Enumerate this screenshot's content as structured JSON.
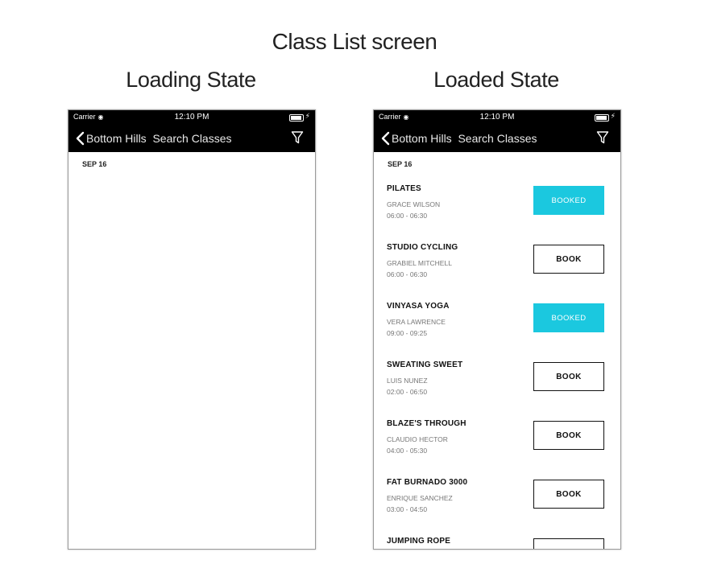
{
  "page_title": "Class List screen",
  "loading": {
    "state_title": "Loading State",
    "status": {
      "carrier": "Carrier",
      "time": "12:10 PM"
    },
    "nav": {
      "title": "Bottom Hills  Search Classes"
    },
    "date_label": "SEP 16"
  },
  "loaded": {
    "state_title": "Loaded State",
    "status": {
      "carrier": "Carrier",
      "time": "12:10 PM"
    },
    "nav": {
      "title": "Bottom Hills  Search Classes"
    },
    "date_label": "SEP 16",
    "classes": [
      {
        "name": "PILATES",
        "instructor": "GRACE WILSON",
        "time": "06:00 - 06:30",
        "button": "BOOKED",
        "booked": true
      },
      {
        "name": "STUDIO CYCLING",
        "instructor": "GRABIEL MITCHELL",
        "time": "06:00 - 06:30",
        "button": "BOOK",
        "booked": false
      },
      {
        "name": "VINYASA YOGA",
        "instructor": "VERA LAWRENCE",
        "time": "09:00 - 09:25",
        "button": "BOOKED",
        "booked": true
      },
      {
        "name": "SWEATING SWEET",
        "instructor": "LUIS NUNEZ",
        "time": "02:00 - 06:50",
        "button": "BOOK",
        "booked": false
      },
      {
        "name": "BLAZE'S THROUGH",
        "instructor": "CLAUDIO HECTOR",
        "time": "04:00 - 05:30",
        "button": "BOOK",
        "booked": false
      },
      {
        "name": "FAT BURNADO 3000",
        "instructor": "ENRIQUE SANCHEZ",
        "time": "03:00 - 04:50",
        "button": "BOOK",
        "booked": false
      },
      {
        "name": "JUMPING ROPE",
        "instructor": "",
        "time": "",
        "button": "",
        "booked": false
      }
    ]
  },
  "colors": {
    "booked": "#1bc8df",
    "navbar": "#000000",
    "accent_text": "#ffffff"
  }
}
